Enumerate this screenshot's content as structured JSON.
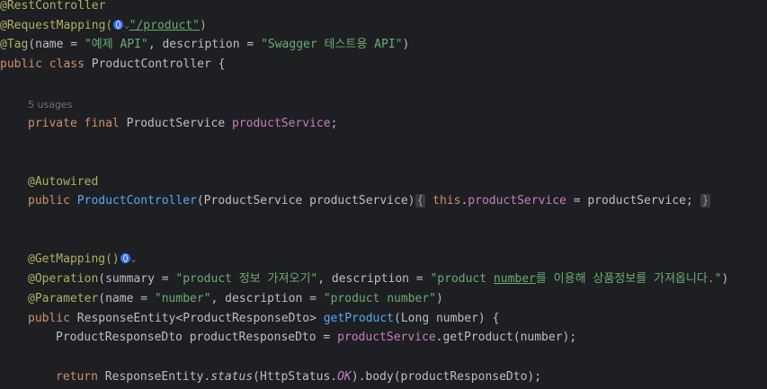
{
  "code": {
    "l1_ann": "@RestController",
    "l2_ann": "@RequestMapping(",
    "l2_str": "\"/product\"",
    "l2_close": ")",
    "l3_ann": "@Tag",
    "l3_a": "(name = ",
    "l3_s1": "\"예제 API\"",
    "l3_b": ", description = ",
    "l3_s2": "\"Swagger 테스트용 API\"",
    "l3_c": ")",
    "l4_kw": "public class ",
    "l4_name": "ProductController {",
    "l5_hint": "5 usages",
    "l6_kw": "private final ",
    "l6_type": "ProductService ",
    "l6_field": "productService",
    "l6_end": ";",
    "l7_ann": "@Autowired",
    "l8_kw": "public ",
    "l8_fn": "ProductController",
    "l8_params": "(ProductService productService)",
    "l8_fold_open": "{",
    "l8_this": "this",
    "l8_dot": ".",
    "l8_field": "productService",
    "l8_assign": " = productService;",
    "l8_fold_close": "}",
    "l9_ann": "@GetMapping()",
    "l10_ann": "@Operation",
    "l10_a": "(summary = ",
    "l10_s1": "\"product 정보 가져오기\"",
    "l10_b": ", description = ",
    "l10_s2a": "\"product ",
    "l10_s2u": "number",
    "l10_s2b": "를 이용해 상품정보를 가져옵니다.\"",
    "l10_c": ")",
    "l11_ann": "@Parameter",
    "l11_a": "(name = ",
    "l11_s1": "\"number\"",
    "l11_b": ", description = ",
    "l11_s2": "\"product number\"",
    "l11_c": ")",
    "l12_kw": "public ",
    "l12_type": "ResponseEntity<ProductResponseDto> ",
    "l12_fn": "getProduct",
    "l12_rest": "(Long number) {",
    "l13_a": "ProductResponseDto productResponseDto = ",
    "l13_field": "productService",
    "l13_b": ".getProduct(number);",
    "l14_kw": "return ",
    "l14_a": "ResponseEntity.",
    "l14_status": "status",
    "l14_b": "(HttpStatus.",
    "l14_ok": "OK",
    "l14_c": ").body(productResponseDto);"
  }
}
